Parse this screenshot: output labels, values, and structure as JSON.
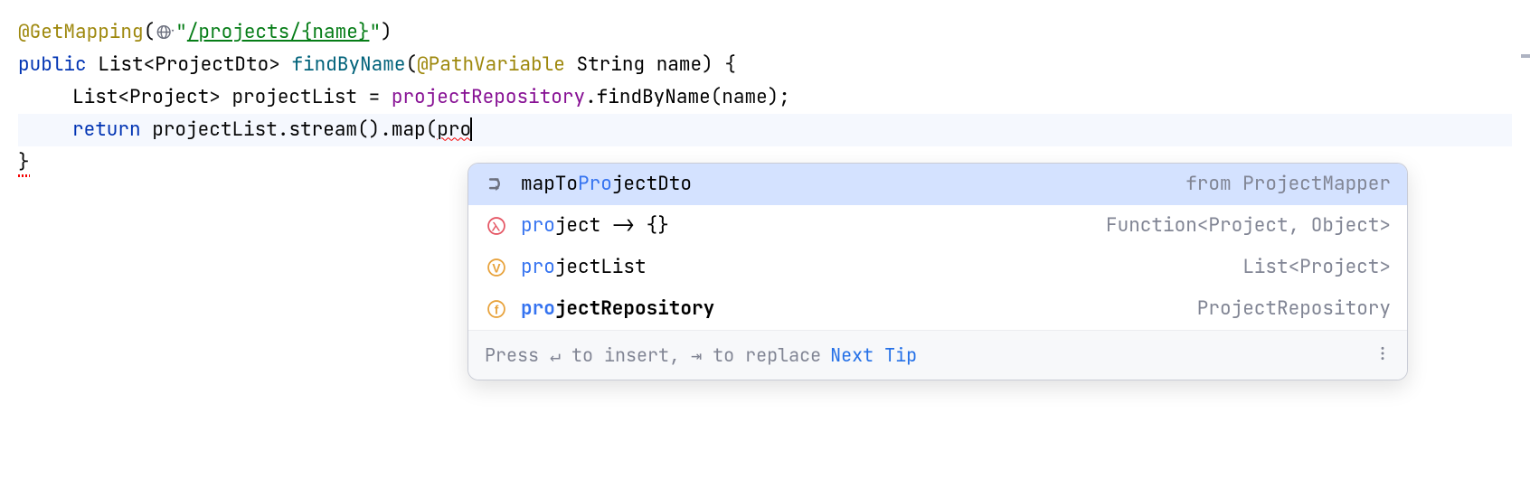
{
  "code": {
    "annotation": "@GetMapping",
    "string_prefix": "\"",
    "string_path": "/projects/{name}",
    "string_suffix": "\"",
    "public": "public",
    "list_type": "List",
    "generic1_open": "<",
    "dto_type": "ProjectDto",
    "generic1_close": ">",
    "method_name": "findByName",
    "path_var_anno": "@PathVariable",
    "string_type": "String",
    "param_name": "name",
    "open_brace": " {",
    "project_type": "Project",
    "var_projectList": "projectList",
    "eq": " = ",
    "repo": "projectRepository",
    "dot": ".",
    "findByName_call": "findByName",
    "open_paren_name": "(name);",
    "return_kw": "return",
    "stream": "stream",
    "map": "map",
    "typed": "pro",
    "close_brace": "}"
  },
  "popup": {
    "items": [
      {
        "label_prefix": "mapTo",
        "label_match": "Pro",
        "label_suffix": "jectDto",
        "type": "from ProjectMapper"
      },
      {
        "label_prefix": "",
        "label_match": "pro",
        "label_suffix": "ject -> {}",
        "type": "Function<Project, Object>"
      },
      {
        "label_prefix": "",
        "label_match": "pro",
        "label_suffix": "jectList",
        "type": "List<Project>"
      },
      {
        "label_prefix": "",
        "label_match": "pro",
        "label_suffix": "jectRepository",
        "type": "ProjectRepository"
      }
    ],
    "footer_hint": "Press ↵ to insert, ⇥ to replace",
    "footer_link": "Next Tip"
  }
}
